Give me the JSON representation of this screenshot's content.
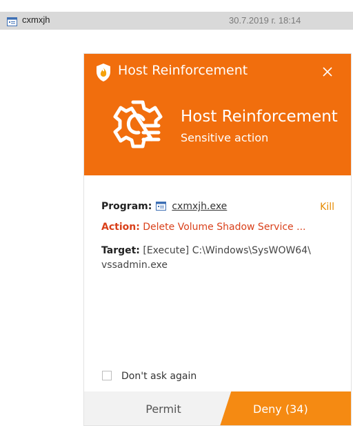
{
  "explorer": {
    "file_name": "cxmxjh",
    "file_date": "30.7.2019 г. 18:14"
  },
  "dialog": {
    "title": "Host Reinforcement",
    "hero_title": "Host Reinforcement",
    "hero_subtitle": "Sensitive action",
    "program_label": "Program:",
    "program_name": "cxmxjh.exe",
    "kill_label": "Kill",
    "action_label": "Action:",
    "action_value": "Delete Volume Shadow Service ...",
    "target_label": "Target:",
    "target_value": "[Execute] C:\\Windows\\SysWOW64\\ vssadmin.exe",
    "dont_ask_label": "Don't ask again",
    "permit_label": "Permit",
    "deny_label": "Deny (34)"
  },
  "colors": {
    "header": "#f16e0d",
    "deny": "#f58a12",
    "action_text": "#d9401a",
    "kill_text": "#e68a00"
  },
  "icons": {
    "logo": "shield-flame-icon",
    "hero": "gear-shield-icon",
    "close": "close-icon",
    "file": "application-window-icon"
  }
}
